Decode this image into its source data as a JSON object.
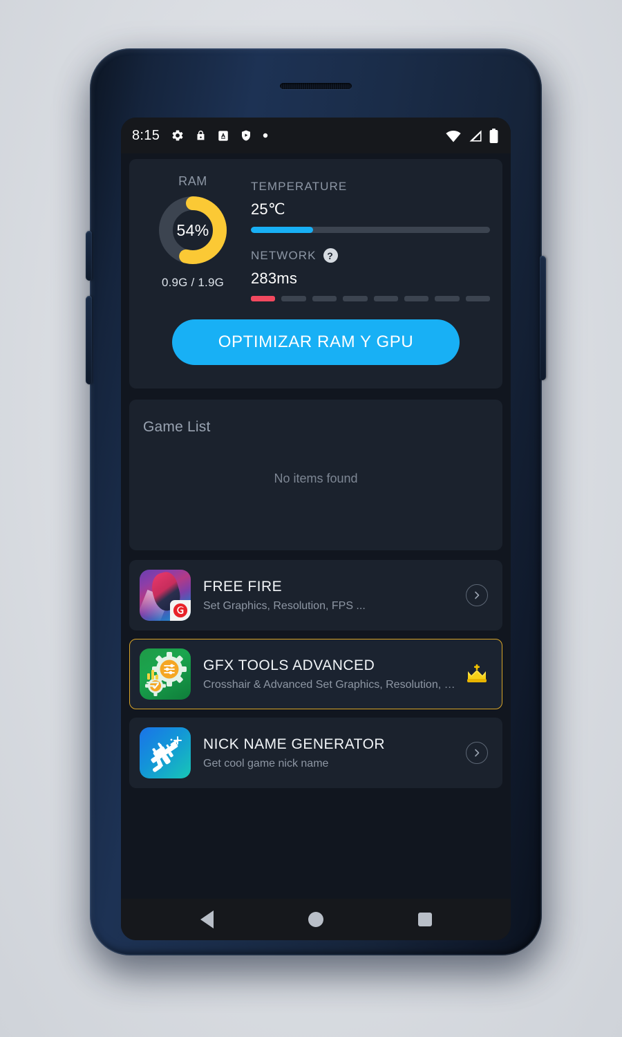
{
  "status_bar": {
    "time": "8:15",
    "left_icons": [
      "gear-icon",
      "lock-icon",
      "a-box-icon",
      "shield-play-icon",
      "dot-icon"
    ],
    "right_icons": [
      "wifi-icon",
      "signal-icon",
      "battery-icon"
    ]
  },
  "stats": {
    "ram": {
      "label": "RAM",
      "percent_text": "54%",
      "percent_value": 54,
      "usage_text": "0.9G / 1.9G",
      "arc_color": "#fbc935",
      "track_color": "#3c4450"
    },
    "temperature": {
      "label": "TEMPERATURE",
      "value_text": "25℃",
      "fill_percent": 26,
      "fill_color": "#18b0f5"
    },
    "network": {
      "label": "NETWORK",
      "help_glyph": "?",
      "value_text": "283ms",
      "segments_total": 8,
      "segments_active": 1,
      "active_color": "#f2495f",
      "inactive_color": "#3c4450"
    },
    "optimize_button": "OPTIMIZAR RAM Y GPU",
    "optimize_button_color": "#18b0f5"
  },
  "game_list": {
    "title": "Game List",
    "empty_text": "No items found"
  },
  "app_rows": [
    {
      "title": "FREE FIRE",
      "subtitle": "Set Graphics, Resolution, FPS ...",
      "icon": "free-fire-icon",
      "action": "chevron-right-icon",
      "highlighted": false
    },
    {
      "title": "GFX TOOLS ADVANCED",
      "subtitle": "Crosshair & Advanced Set Graphics, Resolution, FP...",
      "icon": "gfx-tools-icon",
      "action": "crown-icon",
      "highlighted": true,
      "border_color": "#d9a528"
    },
    {
      "title": "NICK NAME GENERATOR",
      "subtitle": "Get cool game nick name",
      "icon": "sniper-rifle-icon",
      "action": "chevron-right-icon",
      "highlighted": false
    }
  ],
  "nav_bar": {
    "back": "back-triangle-icon",
    "home": "home-circle-icon",
    "recents": "recents-square-icon"
  }
}
